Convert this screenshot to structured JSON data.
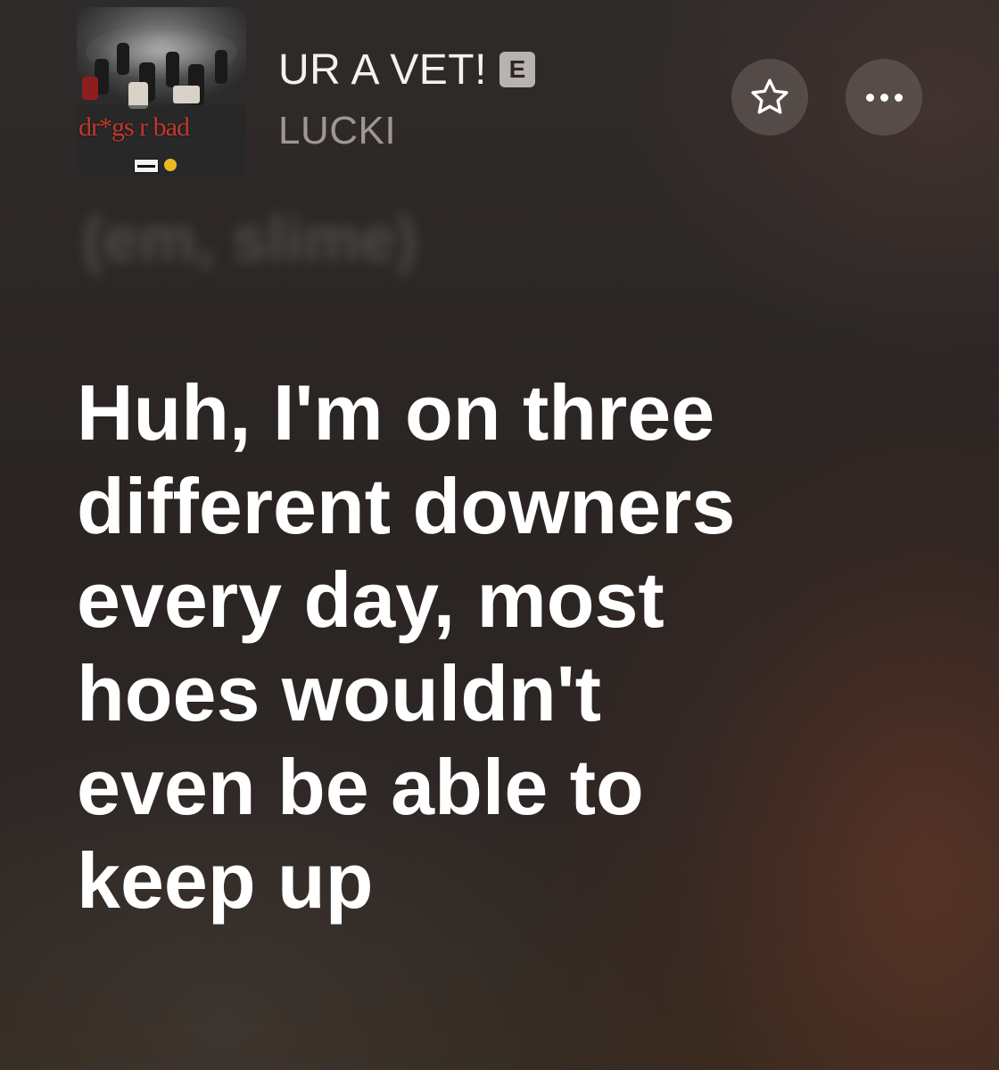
{
  "now_playing": {
    "title": "UR A VET!",
    "explicit_badge": "E",
    "artist": "LUCKI",
    "artwork": {
      "label": "album-artwork",
      "title_text": "dr*gs r bad"
    },
    "favorite_icon": "star-outline-icon",
    "more_icon": "ellipsis-icon"
  },
  "lyrics": {
    "previous_line": "(em, slime)",
    "current_line": [
      "Huh, I'm on three",
      "different downers",
      "every day, most",
      "hoes wouldn't",
      "even be able to",
      "keep up"
    ]
  },
  "colors": {
    "background": "#2c2624",
    "title": "#f4f1ef",
    "artist": "#9e9793",
    "lyric_active": "#ffffff",
    "artwork_title": "#c0392b"
  }
}
